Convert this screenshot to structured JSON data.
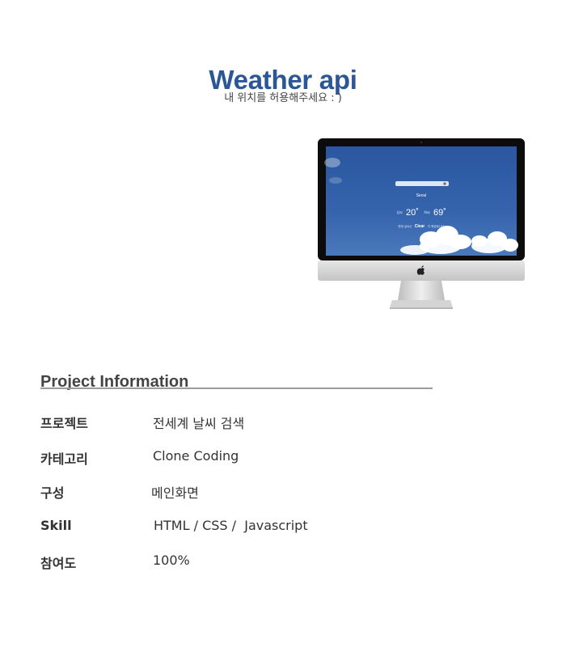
{
  "header": {
    "title": "Weather api",
    "subtitle": "내 위치를 허용해주세요 : )"
  },
  "preview": {
    "screen_small_input": "···",
    "city": "Seoul",
    "temp_celsius": "20˚",
    "temp_fahrenheit": "69˚",
    "low_label": "섭씨",
    "high_label": "화씨",
    "status_left": "현재 날씨는",
    "status_main": "Clear",
    "status_right": "이 예상됩니다",
    "icon": "apple-logo-icon"
  },
  "project_info": {
    "heading": "Project Information",
    "rows": [
      {
        "label": "프로젝트",
        "value": "전세계 날씨 검색"
      },
      {
        "label": "카테고리",
        "value": "Clone Coding"
      },
      {
        "label": "구성",
        "value": "메인화면"
      },
      {
        "label": "Skill",
        "value": "HTML / CSS /  Javascript"
      },
      {
        "label": "참여도",
        "value": "100%"
      }
    ]
  },
  "colors": {
    "title": "#2b5797",
    "sky": "#2f5ea8",
    "rule": "#9c9c9c"
  }
}
